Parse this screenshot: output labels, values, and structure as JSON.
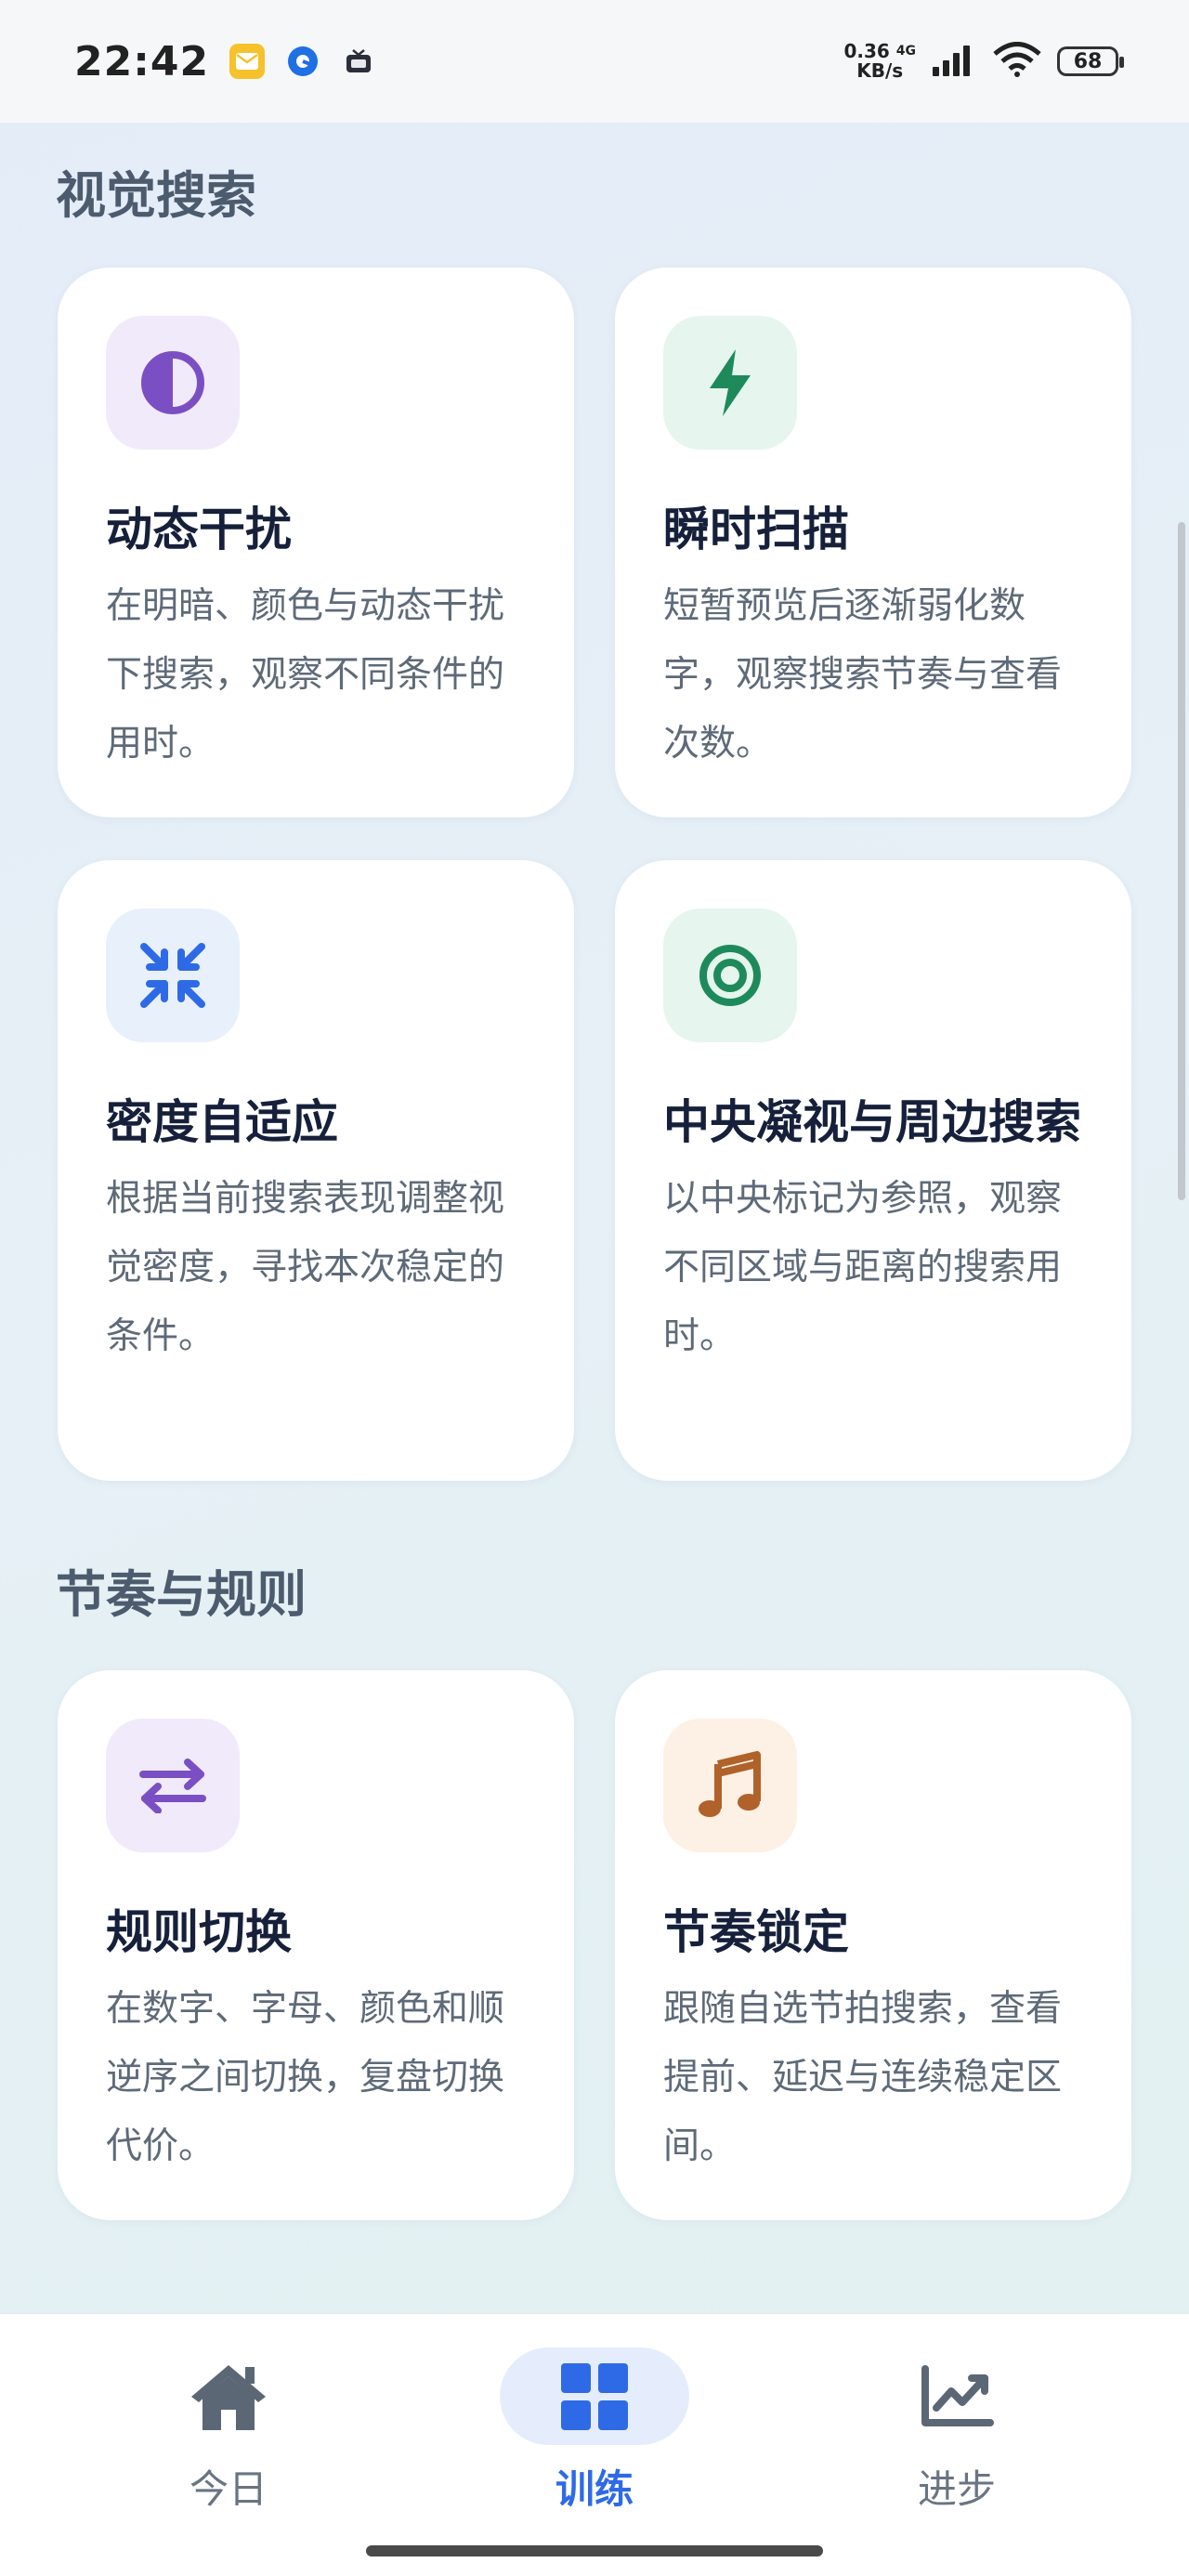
{
  "status_bar": {
    "time": "22:42",
    "net_speed_value": "0.36",
    "net_speed_unit": "KB/s",
    "network_type": "4G",
    "battery": "68",
    "notification_icons": [
      "mail-app-icon",
      "browser-app-icon",
      "tv-app-icon"
    ]
  },
  "sections": [
    {
      "title": "视觉搜索",
      "cards": [
        {
          "title": "动态干扰",
          "desc": "在明暗、颜色与动态干扰下搜索，观察不同条件的用时。",
          "icon": "contrast-icon",
          "icon_color": "#7b4fc4",
          "icon_bg": "#f0eafa"
        },
        {
          "title": "瞬时扫描",
          "desc": "短暂预览后逐渐弱化数字，观察搜索节奏与查看次数。",
          "icon": "lightning-icon",
          "icon_color": "#1e8a5c",
          "icon_bg": "#e6f5ee"
        },
        {
          "title": "密度自适应",
          "desc": "根据当前搜索表现调整视觉密度，寻找本次稳定的条件。",
          "icon": "compress-arrows-icon",
          "icon_color": "#2f6ae6",
          "icon_bg": "#e8f0fc"
        },
        {
          "title": "中央凝视与周边搜索",
          "desc": "以中央标记为参照，观察不同区域与距离的搜索用时。",
          "icon": "target-icon",
          "icon_color": "#1e8a5c",
          "icon_bg": "#e6f5ee"
        }
      ]
    },
    {
      "title": "节奏与规则",
      "cards": [
        {
          "title": "规则切换",
          "desc": "在数字、字母、颜色和顺逆序之间切换，复盘切换代价。",
          "icon": "swap-arrows-icon",
          "icon_color": "#7b4fc4",
          "icon_bg": "#f0eafa"
        },
        {
          "title": "节奏锁定",
          "desc": "跟随自选节拍搜索，查看提前、延迟与连续稳定区间。",
          "icon": "music-note-icon",
          "icon_color": "#b0622a",
          "icon_bg": "#fdf0e4"
        }
      ]
    }
  ],
  "bottom_nav": {
    "items": [
      {
        "label": "今日",
        "icon": "home-icon",
        "active": false
      },
      {
        "label": "训练",
        "icon": "grid-icon",
        "active": true
      },
      {
        "label": "进步",
        "icon": "trend-chart-icon",
        "active": false
      }
    ]
  },
  "colors": {
    "accent": "#2f6ae6",
    "active_nav_bg": "#e5edfc",
    "nav_inactive": "#6a7482"
  }
}
